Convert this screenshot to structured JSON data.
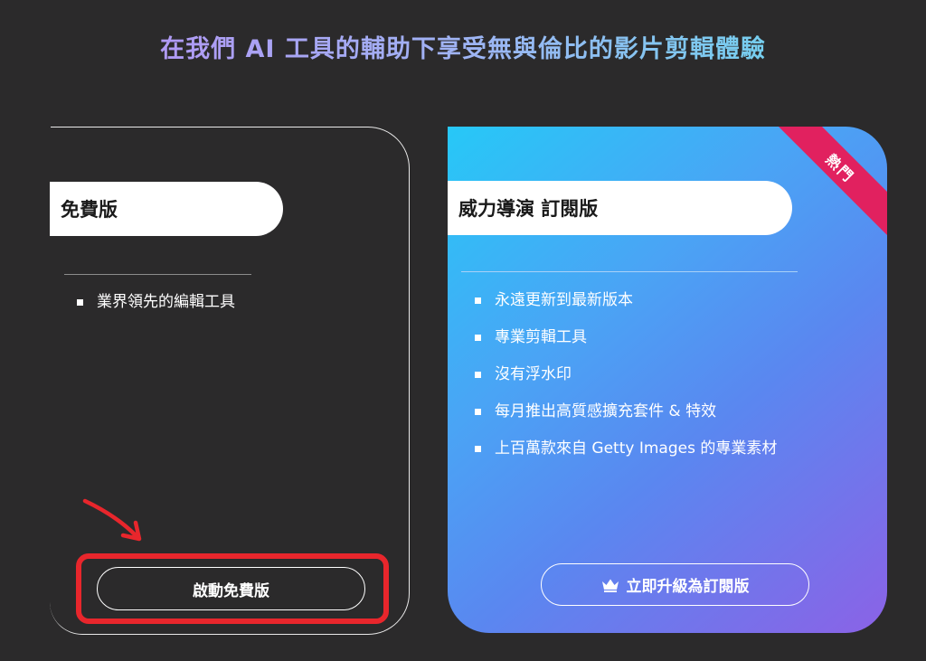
{
  "headline": "在我們 AI 工具的輔助下享受無與倫比的影片剪輯體驗",
  "free_plan": {
    "title": "免費版",
    "features": [
      "業界領先的編輯工具"
    ],
    "button_label": "啟動免費版"
  },
  "pro_plan": {
    "title": "威力導演 訂閱版",
    "badge": "熱門",
    "features": [
      "永遠更新到最新版本",
      "專業剪輯工具",
      "沒有浮水印",
      "每月推出高質感擴充套件 & 特效",
      "上百萬款來自 Getty Images 的專業素材"
    ],
    "button_label": "立即升級為訂閱版",
    "button_icon": "crown-icon"
  },
  "colors": {
    "background": "#2b2a2b",
    "highlight": "#e8262c",
    "badge": "#e1215f",
    "pro_gradient_start": "#27c8f7",
    "pro_gradient_end": "#8b62e6"
  }
}
